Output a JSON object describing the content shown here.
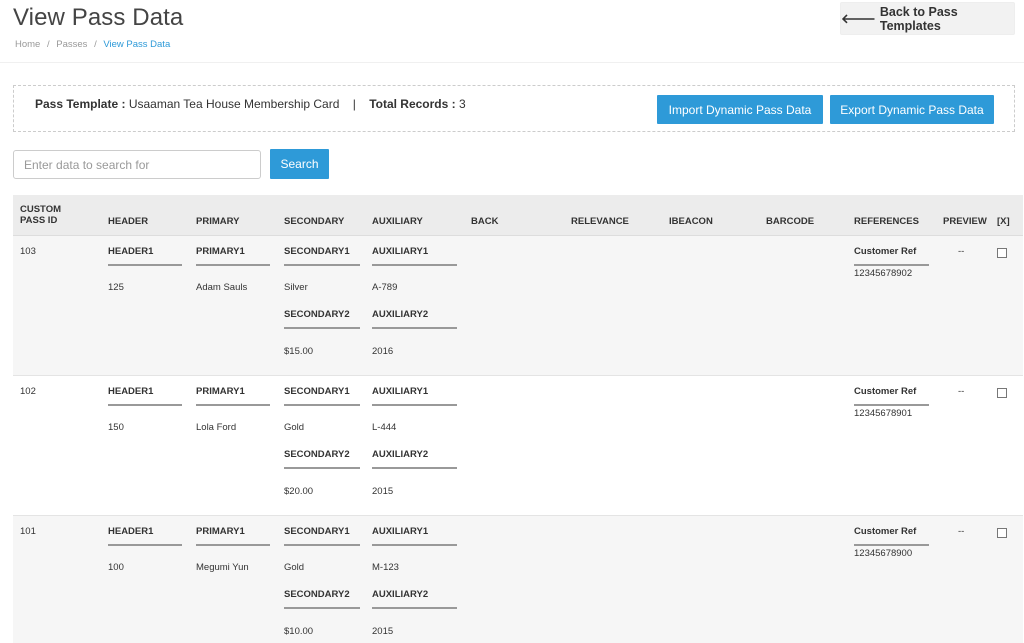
{
  "page": {
    "title": "View Pass Data"
  },
  "breadcrumb": {
    "home": "Home",
    "sep1": "/",
    "passes": "Passes",
    "sep2": "/",
    "current": "View Pass Data"
  },
  "back_button": {
    "icon": "arrow-left-icon",
    "label": "Back to Pass Templates",
    "arrow": "🡐"
  },
  "info": {
    "template_label": "Pass Template :",
    "template_value": "Usaaman Tea House Membership Card",
    "pipe": "|",
    "records_label": "Total Records :",
    "records_value": "3"
  },
  "actions": {
    "import_label": "Import Dynamic Pass Data",
    "export_label": "Export Dynamic Pass Data"
  },
  "search": {
    "placeholder": "Enter data to search for",
    "button_label": "Search"
  },
  "table": {
    "columns": [
      "CUSTOM PASS ID",
      "HEADER",
      "PRIMARY",
      "SECONDARY",
      "AUXILIARY",
      "BACK",
      "RELEVANCE",
      "IBEACON",
      "BARCODE",
      "REFERENCES",
      "PREVIEW",
      "[X]"
    ],
    "rows": [
      {
        "id": "103",
        "header_label": "HEADER1",
        "header_value": "125",
        "primary_label": "PRIMARY1",
        "primary_value": "Adam Sauls",
        "secondary1_label": "SECONDARY1",
        "secondary1_value": "Silver",
        "secondary2_label": "SECONDARY2",
        "secondary2_value": "$15.00",
        "auxiliary1_label": "AUXILIARY1",
        "auxiliary1_value": "A-789",
        "auxiliary2_label": "AUXILIARY2",
        "auxiliary2_value": "2016",
        "ref_label": "Customer Ref",
        "ref_value": "12345678902",
        "preview": "--"
      },
      {
        "id": "102",
        "header_label": "HEADER1",
        "header_value": "150",
        "primary_label": "PRIMARY1",
        "primary_value": "Lola Ford",
        "secondary1_label": "SECONDARY1",
        "secondary1_value": "Gold",
        "secondary2_label": "SECONDARY2",
        "secondary2_value": "$20.00",
        "auxiliary1_label": "AUXILIARY1",
        "auxiliary1_value": "L-444",
        "auxiliary2_label": "AUXILIARY2",
        "auxiliary2_value": "2015",
        "ref_label": "Customer Ref",
        "ref_value": "12345678901",
        "preview": "--"
      },
      {
        "id": "101",
        "header_label": "HEADER1",
        "header_value": "100",
        "primary_label": "PRIMARY1",
        "primary_value": "Megumi Yun",
        "secondary1_label": "SECONDARY1",
        "secondary1_value": "Gold",
        "secondary2_label": "SECONDARY2",
        "secondary2_value": "$10.00",
        "auxiliary1_label": "AUXILIARY1",
        "auxiliary1_value": "M-123",
        "auxiliary2_label": "AUXILIARY2",
        "auxiliary2_value": "2015",
        "ref_label": "Customer Ref",
        "ref_value": "12345678900",
        "preview": "--"
      }
    ]
  },
  "colors": {
    "accent": "#2e9ad8",
    "header_bg": "#ececec",
    "row_alt_bg": "#f6f6f6"
  }
}
